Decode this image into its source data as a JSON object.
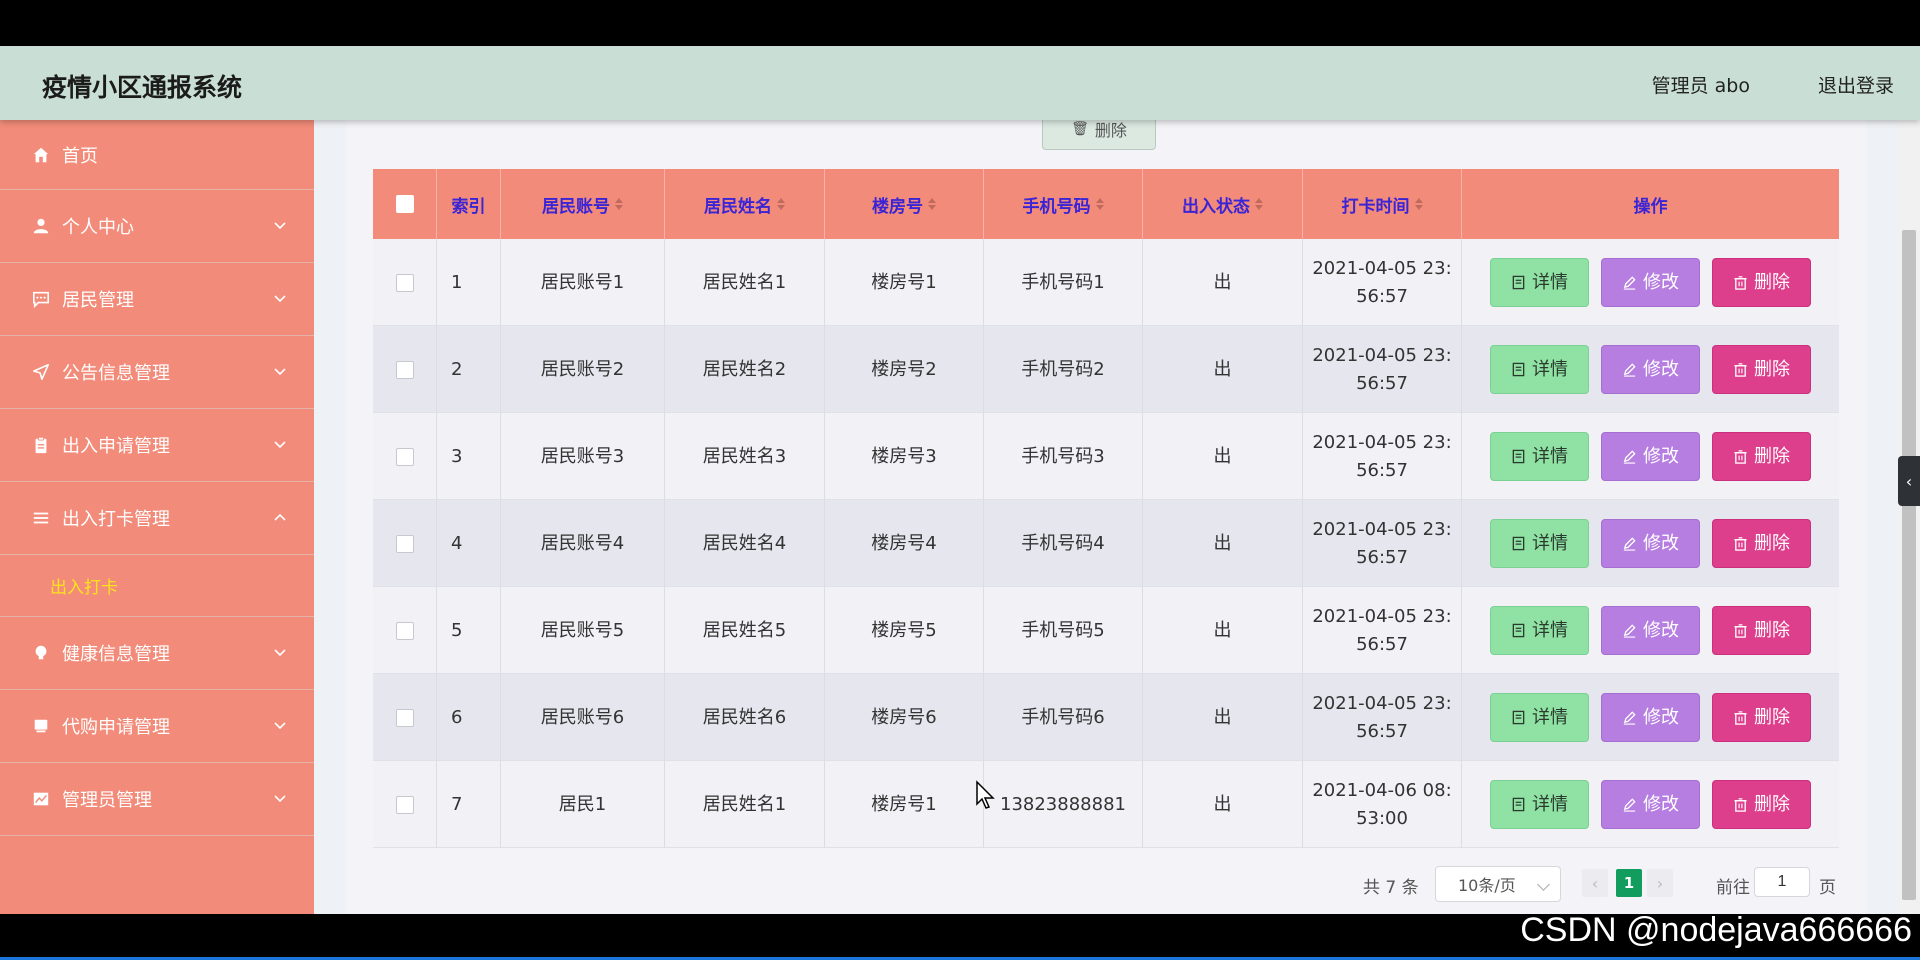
{
  "header": {
    "title": "疫情小区通报系统",
    "admin": "管理员 abo",
    "logout": "退出登录"
  },
  "sidebar": {
    "items": [
      {
        "label": "首页",
        "icon": "home-icon"
      },
      {
        "label": "个人中心",
        "icon": "user-icon"
      },
      {
        "label": "居民管理",
        "icon": "chat-icon"
      },
      {
        "label": "公告信息管理",
        "icon": "send-icon"
      },
      {
        "label": "出入申请管理",
        "icon": "clipboard-icon"
      },
      {
        "label": "出入打卡管理",
        "icon": "list-icon"
      },
      {
        "label": "健康信息管理",
        "icon": "bulb-icon"
      },
      {
        "label": "代购申请管理",
        "icon": "box-icon"
      },
      {
        "label": "管理员管理",
        "icon": "chart-icon"
      }
    ],
    "sub_item": "出入打卡"
  },
  "toolbar": {
    "delete_label": "删除"
  },
  "table": {
    "columns": [
      "索引",
      "居民账号",
      "居民姓名",
      "楼房号",
      "手机号码",
      "出入状态",
      "打卡时间",
      "操作"
    ],
    "rows": [
      {
        "idx": "1",
        "account": "居民账号1",
        "name": "居民姓名1",
        "building": "楼房号1",
        "phone": "手机号码1",
        "status": "出",
        "time1": "2021-04-05 23:",
        "time2": "56:57"
      },
      {
        "idx": "2",
        "account": "居民账号2",
        "name": "居民姓名2",
        "building": "楼房号2",
        "phone": "手机号码2",
        "status": "出",
        "time1": "2021-04-05 23:",
        "time2": "56:57"
      },
      {
        "idx": "3",
        "account": "居民账号3",
        "name": "居民姓名3",
        "building": "楼房号3",
        "phone": "手机号码3",
        "status": "出",
        "time1": "2021-04-05 23:",
        "time2": "56:57"
      },
      {
        "idx": "4",
        "account": "居民账号4",
        "name": "居民姓名4",
        "building": "楼房号4",
        "phone": "手机号码4",
        "status": "出",
        "time1": "2021-04-05 23:",
        "time2": "56:57"
      },
      {
        "idx": "5",
        "account": "居民账号5",
        "name": "居民姓名5",
        "building": "楼房号5",
        "phone": "手机号码5",
        "status": "出",
        "time1": "2021-04-05 23:",
        "time2": "56:57"
      },
      {
        "idx": "6",
        "account": "居民账号6",
        "name": "居民姓名6",
        "building": "楼房号6",
        "phone": "手机号码6",
        "status": "出",
        "time1": "2021-04-05 23:",
        "time2": "56:57"
      },
      {
        "idx": "7",
        "account": "居民1",
        "name": "居民姓名1",
        "building": "楼房号1",
        "phone": "13823888881",
        "status": "出",
        "time1": "2021-04-06 08:",
        "time2": "53:00"
      }
    ],
    "actions": {
      "detail": "详情",
      "edit": "修改",
      "delete": "删除"
    }
  },
  "pagination": {
    "total": "共 7 条",
    "page_size": "10条/页",
    "current": "1",
    "goto_label": "前往",
    "goto_value": "1",
    "page_unit": "页"
  },
  "watermark": "CSDN @nodejava666666",
  "colors": {
    "header_bg": "#c9dfd6",
    "sidebar_bg": "#f28b79",
    "active_sub": "#ffe31a",
    "detail_btn": "#8fe2a4",
    "edit_btn": "#b67ee0",
    "delete_btn": "#de3f8d",
    "page_active": "#129d5e"
  }
}
